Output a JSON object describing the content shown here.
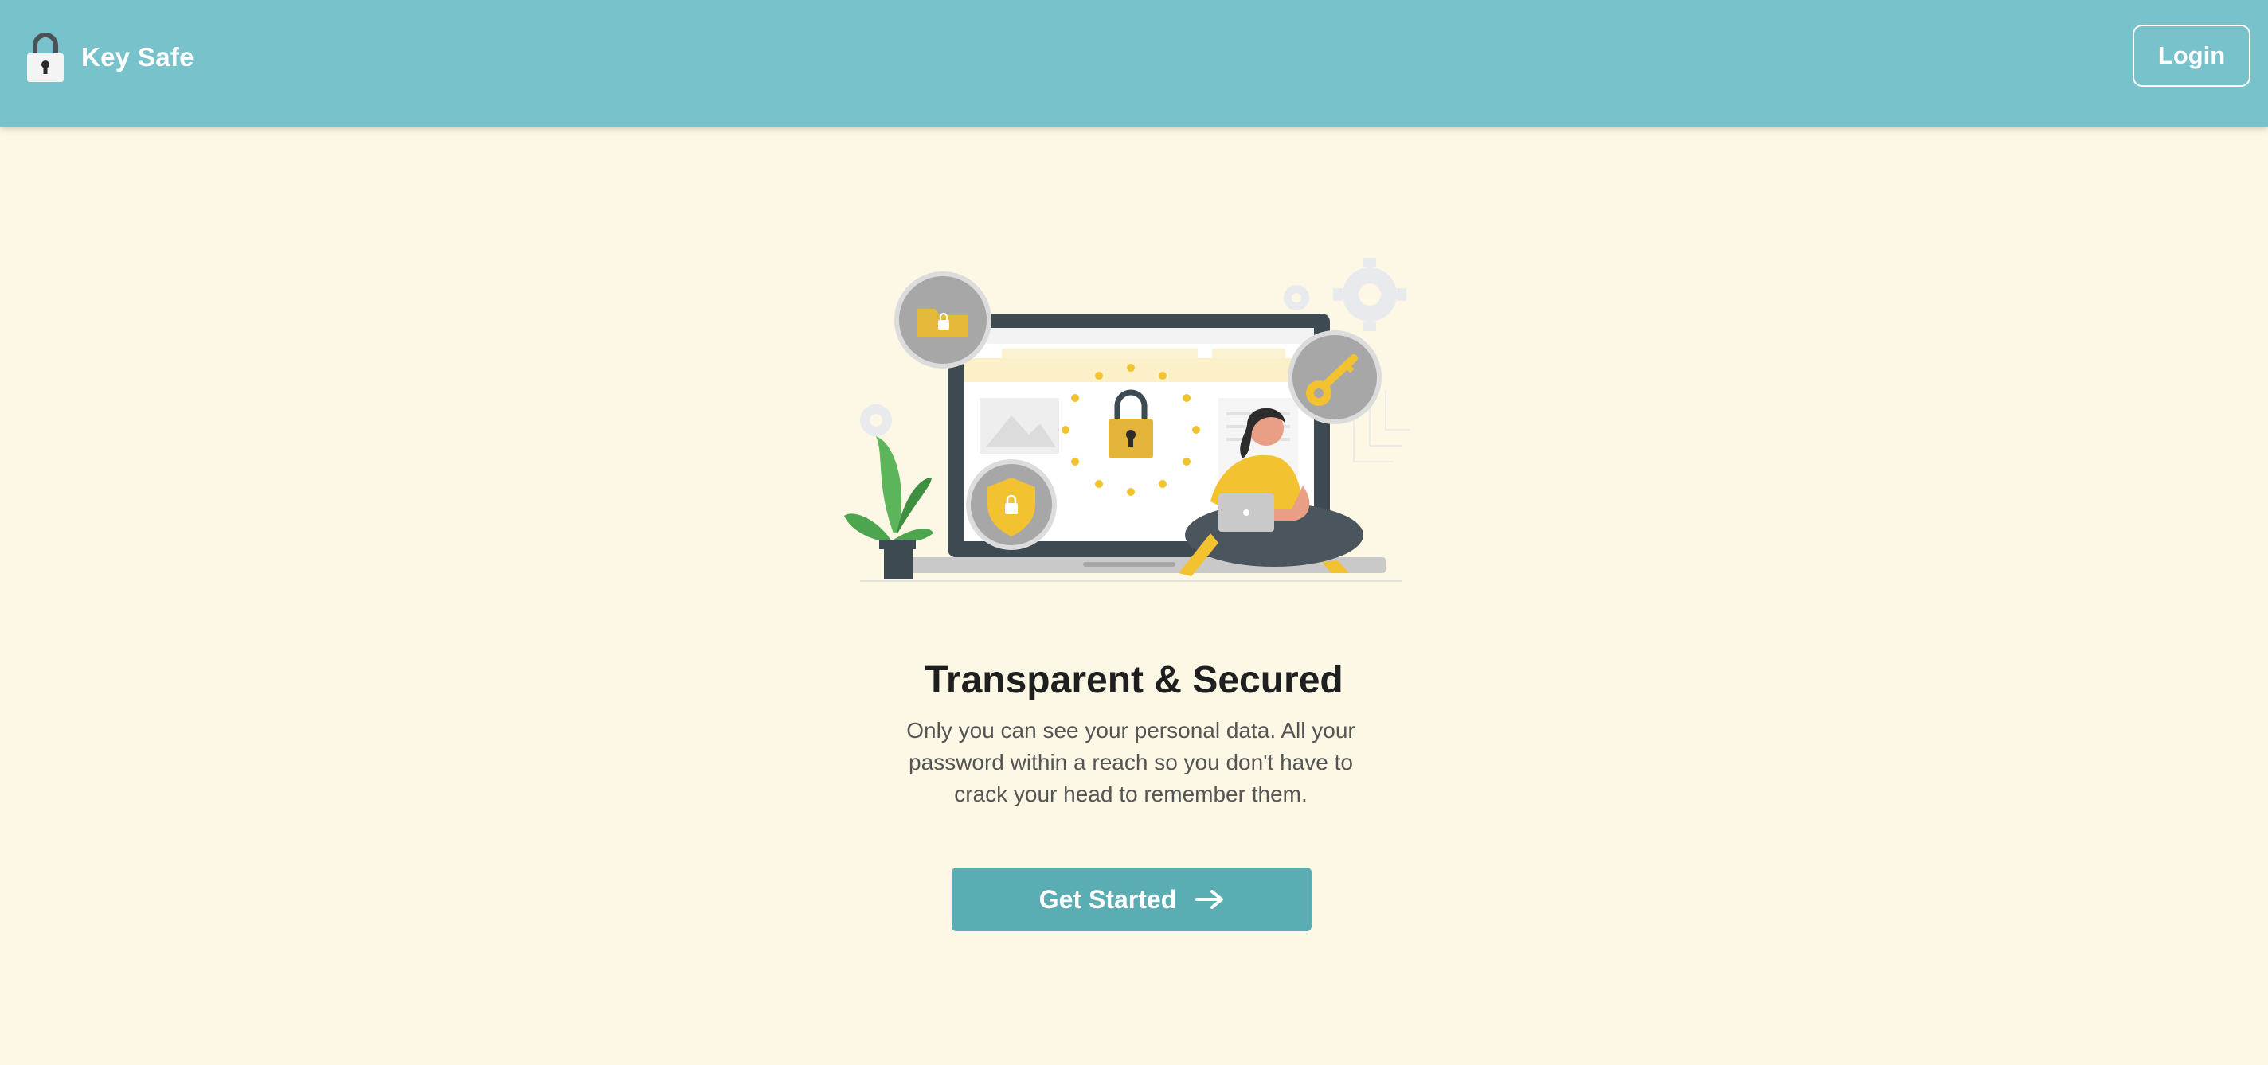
{
  "header": {
    "brand_name": "Key Safe",
    "brand_icon": "padlock-icon",
    "login_label": "Login"
  },
  "hero": {
    "illustration": "security-illustration",
    "title": "Transparent & Secured",
    "description": "Only you can see your personal data. All your password within a reach so you don't have to crack your head to remember them.",
    "cta_label": "Get Started",
    "cta_icon": "arrow-right-icon"
  },
  "colors": {
    "navbar": "#78c2cc",
    "background": "#fdf7e5",
    "cta": "#5aaeb3",
    "accent_yellow": "#f2c230"
  }
}
